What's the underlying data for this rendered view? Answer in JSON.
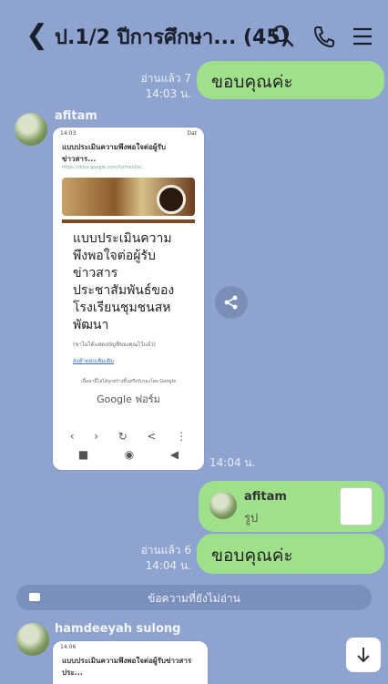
{
  "header": {
    "back_icon": "chevron-left-icon",
    "title": "ป.1/2 ปีการศึกษา... (45)",
    "icons": [
      "search-icon",
      "phone-icon",
      "menu-icon"
    ]
  },
  "messages": {
    "m1": {
      "read": "อ่านแล้ว 7",
      "time": "14:03 น.",
      "text": "ขอบคุณค่ะ"
    },
    "m2": {
      "sender": "afitam",
      "time": "14:04 น.",
      "shot": {
        "status_left": "14:03",
        "status_right": "Dat",
        "page_title": "แบบประเมินความพึงพอใจต่อผู้รับข่าวสาร...",
        "page_url": "https://docs.google.com/forms/d/e/...",
        "form_title": "แบบประเมินความพึงพอใจต่อผู้รับข่าวสาร ประชาสัมพันธ์ของ โรงเรียนชุมชนสหพัฒนา",
        "note": "(ขาไม่ได้แสดงบัญชีของคุณไว้แล้ว)",
        "link": "ส่งคำตอบเพิ่มเติม",
        "footer": "เนื้อหานี้ไม่ได้ถูกสร้างขึ้นหรือรับรองโดย Google",
        "brand": "Google ฟอร์ม"
      }
    },
    "m3": {
      "name": "afitam",
      "subtitle": "รูป"
    },
    "m4": {
      "read": "อ่านแล้ว 6",
      "time": "14:04 น.",
      "text": "ขอบคุณค่ะ"
    },
    "unread_label": "ข้อความที่ยังไม่อ่าน",
    "m5": {
      "sender": "hamdeeyah sulong",
      "shot": {
        "status_left": "14:06",
        "page_title": "แบบประเมินความพึงพอใจต่อผู้รับข่าวสารประ..."
      }
    }
  },
  "colors": {
    "background": "#8fa3cf",
    "bubble_out": "#9fe08a",
    "unread_bar": "#7b8fbc"
  }
}
